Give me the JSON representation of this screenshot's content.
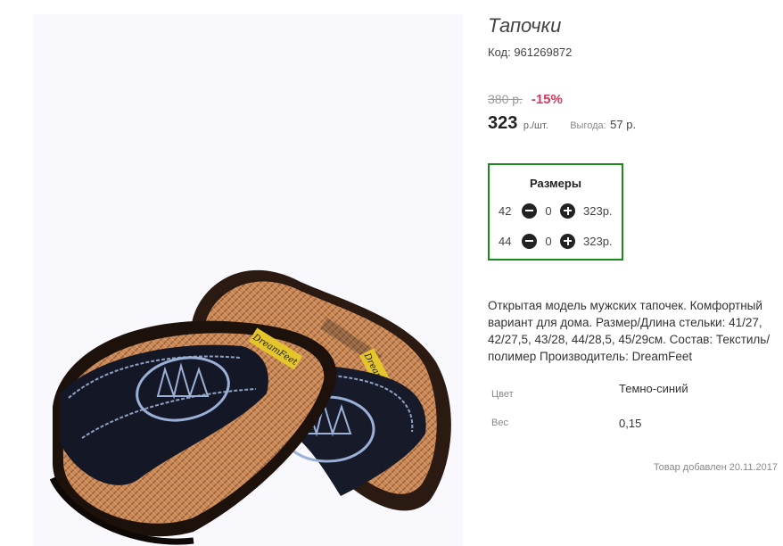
{
  "product": {
    "title": "Тапочки",
    "code": "Код: 961269872",
    "old_price": "380 р.",
    "discount": "-15%",
    "price": "323",
    "price_unit": "р./шт.",
    "savings_label": "Выгода:",
    "savings_value": "57 р.",
    "image_alt": "men's slippers",
    "brand_text": "DreamFeet"
  },
  "sizes": {
    "title": "Размеры",
    "rows": [
      {
        "size": "42",
        "qty": "0",
        "price": "323р."
      },
      {
        "size": "44",
        "qty": "0",
        "price": "323р."
      }
    ]
  },
  "description": "Открытая модель мужских тапочек. Комфортный вариант для дома. Размер/Длина стельки: 41/27, 42/27,5, 43/28, 44/28,5, 45/29см. Состав: Текстиль/полимер Производитель: DreamFeet",
  "specs": [
    {
      "label": "Цвет",
      "value": "Темно-синий"
    },
    {
      "label": "Вес",
      "value": "0,15"
    }
  ],
  "added": "Товар добавлен 20.11.2017",
  "colors": {
    "accent_border": "#1a8a1a",
    "discount": "#d23b5a"
  }
}
